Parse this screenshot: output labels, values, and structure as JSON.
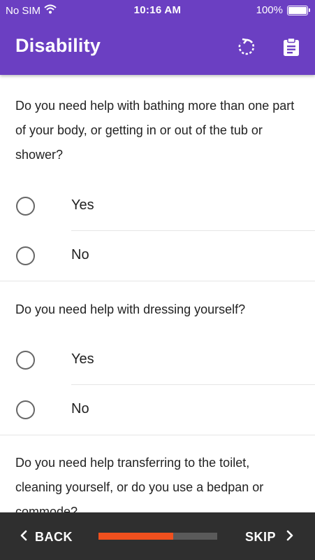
{
  "status_bar": {
    "carrier": "No SIM",
    "time": "10:16 AM",
    "battery": "100%"
  },
  "header": {
    "title": "Disability",
    "icons": [
      "reset-icon",
      "clipboard-icon"
    ],
    "background": "#6b3fc2"
  },
  "questions": [
    {
      "text": "Do you need help with bathing more than one part of your body, or getting in or out of the tub or shower?",
      "options": [
        "Yes",
        "No"
      ]
    },
    {
      "text": "Do you need help with dressing yourself?",
      "options": [
        "Yes",
        "No"
      ]
    },
    {
      "text": "Do you need help transferring to the toilet, cleaning yourself, or do you use a bedpan or commode?",
      "options": []
    }
  ],
  "footer": {
    "back_label": "BACK",
    "skip_label": "SKIP",
    "progress": 0.63,
    "progress_color": "#f0501e"
  }
}
